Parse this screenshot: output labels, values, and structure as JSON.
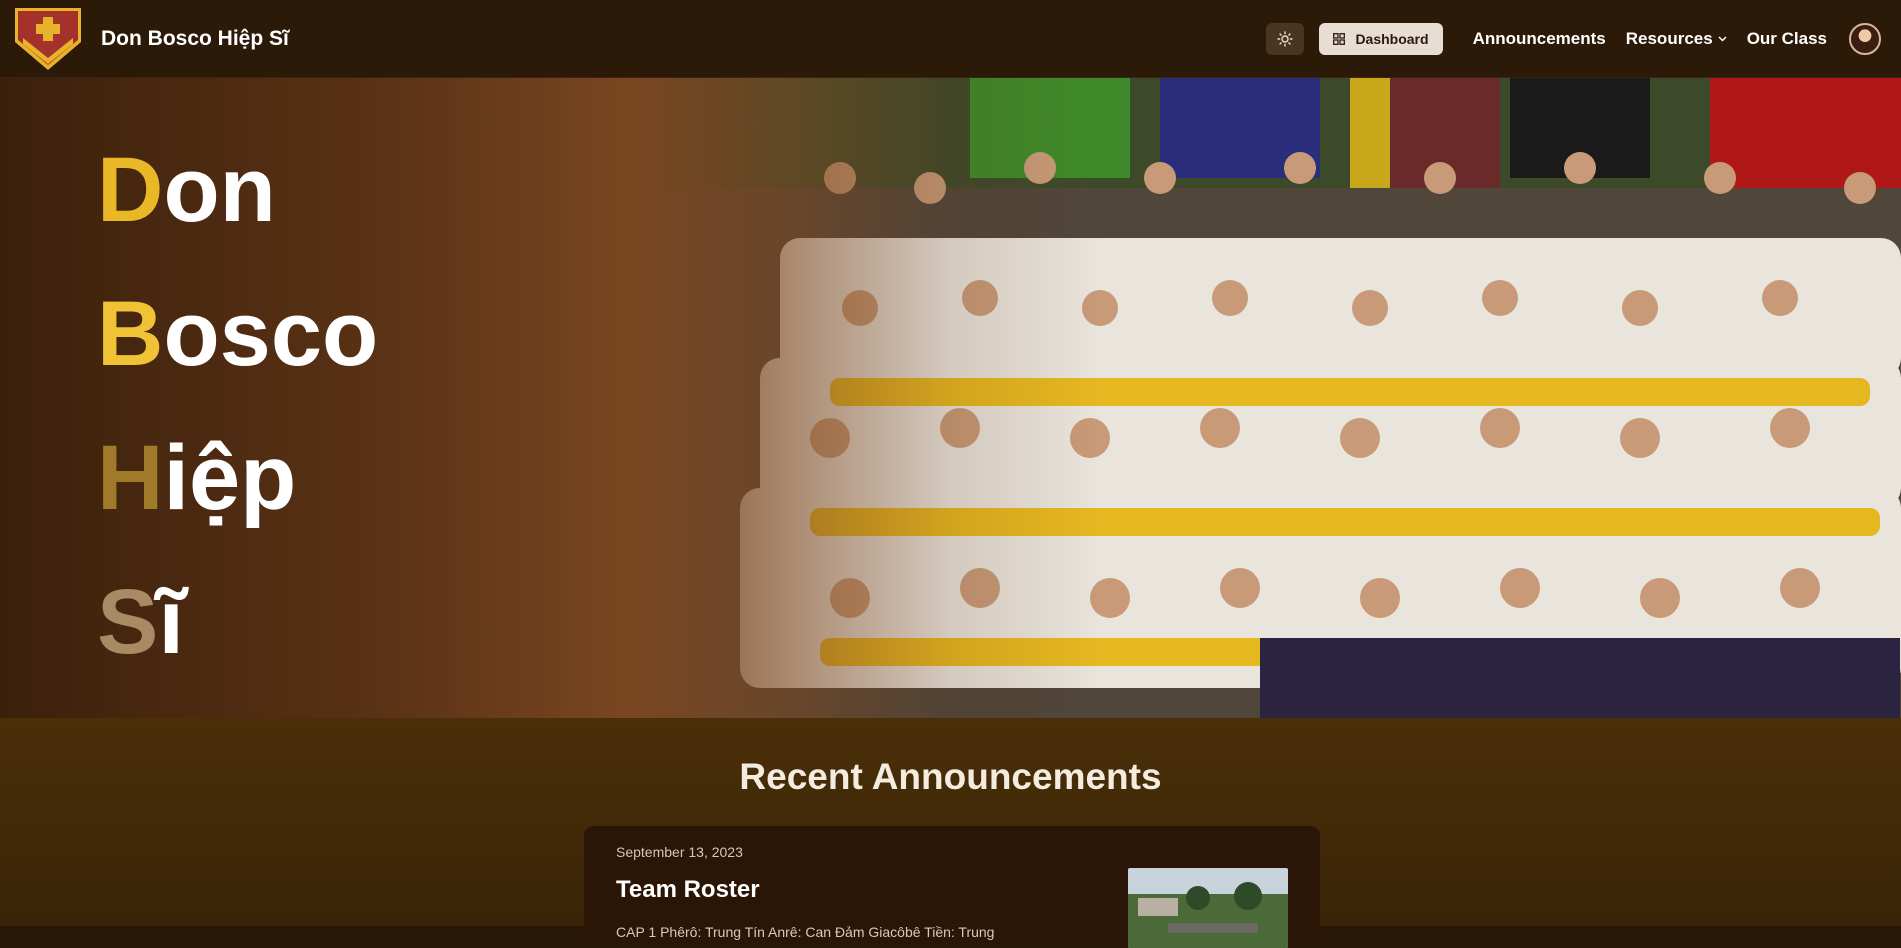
{
  "navbar": {
    "site_name": "Don Bosco Hiệp Sĩ",
    "dashboard_label": "Dashboard",
    "links": [
      {
        "label": "Announcements"
      },
      {
        "label": "Resources",
        "has_dropdown": true
      },
      {
        "label": "Our Class"
      }
    ]
  },
  "hero": {
    "lines": [
      {
        "initial": "D",
        "rest": "on"
      },
      {
        "initial": "B",
        "rest": "osco"
      },
      {
        "initial": "H",
        "rest": "iệp"
      },
      {
        "initial": "S",
        "rest": "ĩ"
      }
    ]
  },
  "announcements": {
    "heading": "Recent Announcements",
    "items": [
      {
        "date": "September 13, 2023",
        "title": "Team Roster",
        "excerpt": "CAP 1 Phêrô: Trung Tín Anrê: Can Đảm Giacôbê Tiền: Trung"
      }
    ]
  },
  "colors": {
    "nav_bg": "#2c1a09",
    "accent_gold": "#eab826",
    "section_bg": "#4a2f08",
    "card_bg": "#2a1506"
  },
  "icons": {
    "logo": "scout-shield-logo",
    "theme": "sun-icon",
    "dashboard": "grid-icon",
    "dropdown": "chevron-down-icon"
  }
}
